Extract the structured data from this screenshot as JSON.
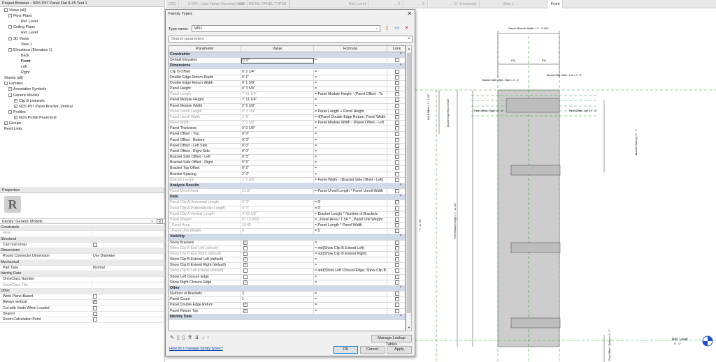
{
  "project_browser": {
    "title": "Project Browser - NDS P57 Panel Flat 8-15 Test 1",
    "items": [
      {
        "label": "Views (all)",
        "depth": 0,
        "toggle": "-"
      },
      {
        "label": "Floor Plans",
        "depth": 1,
        "toggle": "-"
      },
      {
        "label": "Ref. Level",
        "depth": 3,
        "toggle": ""
      },
      {
        "label": "Ceiling Plans",
        "depth": 1,
        "toggle": "-"
      },
      {
        "label": "Ref. Level",
        "depth": 3,
        "toggle": ""
      },
      {
        "label": "3D Views",
        "depth": 1,
        "toggle": "-"
      },
      {
        "label": "View 1",
        "depth": 3,
        "toggle": ""
      },
      {
        "label": "Elevations (Elevation 1)",
        "depth": 1,
        "toggle": "-"
      },
      {
        "label": "Back",
        "depth": 3,
        "toggle": ""
      },
      {
        "label": "Front",
        "depth": 3,
        "toggle": "",
        "bold": true
      },
      {
        "label": "Left",
        "depth": 3,
        "toggle": ""
      },
      {
        "label": "Right",
        "depth": 3,
        "toggle": ""
      },
      {
        "label": "Sheets (all)",
        "depth": 0,
        "toggle": ""
      },
      {
        "label": "Families",
        "depth": 0,
        "toggle": "-"
      },
      {
        "label": "Annotation Symbols",
        "depth": 1,
        "toggle": "+"
      },
      {
        "label": "Generic Models",
        "depth": 1,
        "toggle": "-"
      },
      {
        "label": "Clip B Linework",
        "depth": 2,
        "toggle": "+"
      },
      {
        "label": "NDS P57 Panel Bracket_Vertical",
        "depth": 2,
        "toggle": "+"
      },
      {
        "label": "Profiles",
        "depth": 1,
        "toggle": "-"
      },
      {
        "label": "NDS Profile Panel End",
        "depth": 2,
        "toggle": "+"
      },
      {
        "label": "Groups",
        "depth": 0,
        "toggle": "+"
      },
      {
        "label": "Revit Links",
        "depth": 0,
        "toggle": ""
      }
    ]
  },
  "properties": {
    "title": "Properties",
    "logo_letter": "R",
    "family_label": "Family: Generic Models",
    "rows": [
      {
        "k": "Constraints",
        "sec": true
      },
      {
        "k": "Host",
        "v": "",
        "gray": true
      },
      {
        "k": "Structural",
        "sec": true
      },
      {
        "k": "Can host rebar",
        "cb": false
      },
      {
        "k": "Dimensions",
        "sec": true
      },
      {
        "k": "Round Connector Dimension",
        "v": "Use Diameter"
      },
      {
        "k": "Mechanical",
        "sec": true
      },
      {
        "k": "Part Type",
        "v": "Normal"
      },
      {
        "k": "Identity Data",
        "sec": true
      },
      {
        "k": "OmniClass Number",
        "v": ""
      },
      {
        "k": "OmniClass Title",
        "v": "",
        "gray": true
      },
      {
        "k": "Other",
        "sec": true
      },
      {
        "k": "Work Plane-Based",
        "cb": false
      },
      {
        "k": "Always vertical",
        "cb": true
      },
      {
        "k": "Cut with Voids When Loaded",
        "cb": false
      },
      {
        "k": "Shared",
        "cb": false
      },
      {
        "k": "Room Calculation Point",
        "cb": false
      }
    ]
  },
  "tabs": [
    {
      "label": "{3D}",
      "active": false
    },
    {
      "label": "3-000 - Liber Nolan Opening View",
      "active": false
    },
    {
      "label": "CW - METAL PANEL TYPES",
      "active": false
    },
    {
      "label": "1",
      "active": false
    },
    {
      "label": "Ref. Level",
      "active": false
    },
    {
      "label": "2",
      "active": false
    },
    {
      "label": "3",
      "active": false
    },
    {
      "label": "3 - Unnamed",
      "active": false
    },
    {
      "label": "View 1",
      "active": false
    },
    {
      "label": "Front",
      "active": true
    }
  ],
  "dialog": {
    "title": "Family Types",
    "close": "✕",
    "type_name_label": "Type name:",
    "type_name": "W01",
    "search_placeholder": "Search parameters",
    "columns": [
      "Parameter",
      "Value",
      "Formula",
      "Lock"
    ],
    "rows": [
      {
        "sec": "Constraints"
      },
      {
        "p": "Default Elevation",
        "v": "0' 0\"",
        "f": "=",
        "lock": false,
        "dflt": true
      },
      {
        "sec": "Dimensions"
      },
      {
        "p": "Clip B Offset",
        "v": "0' 2 1/4\"",
        "f": "=",
        "lock": false
      },
      {
        "p": "Double Edge Return Depth",
        "v": "0' 1\"",
        "f": "=",
        "lock": false
      },
      {
        "p": "Double Edge Return Width",
        "v": "0' 1 5/8\"",
        "f": "=",
        "lock": false
      },
      {
        "p": "Panel Height",
        "v": "0' 3 5/8\"",
        "f": "=",
        "lock": false
      },
      {
        "p": "Panel Length",
        "v": "7' 11 1/4\"",
        "f": "= Panel Module Height - (Panel Offset - To",
        "lock": false,
        "gray": true
      },
      {
        "p": "Panel Module Height",
        "v": "7' 11 1/4\"",
        "f": "=",
        "lock": false
      },
      {
        "p": "Panel Module Width",
        "v": "2' 5 3/8\"",
        "f": "=",
        "lock": false
      },
      {
        "p": "Panel Unroll Length",
        "v": "8' 2 7/8\"",
        "f": "= Panel Length + Panel Height",
        "lock": false,
        "gray": true
      },
      {
        "p": "Panel Unroll Width",
        "v": "2' 8\"",
        "f": "= if(Panel Double Edge Return, Panel Width",
        "lock": false,
        "gray": true
      },
      {
        "p": "Panel Width",
        "v": "2' 5 3/8\"",
        "f": "= Panel Module Width - (Panel Offset - Left",
        "lock": false,
        "gray": true
      },
      {
        "p": "Panel Thickness",
        "v": "0' 0 1/8\"",
        "f": "=",
        "lock": false
      },
      {
        "p": "Panel Offset - Top",
        "v": "0' 0\"",
        "f": "=",
        "lock": false
      },
      {
        "p": "Panel Offset - Bottom",
        "v": "0' 0\"",
        "f": "=",
        "lock": false
      },
      {
        "p": "Panel Offset - Left Side",
        "v": "0' 0\"",
        "f": "=",
        "lock": false
      },
      {
        "p": "Panel Offset - Right Side",
        "v": "0' 0\"",
        "f": "=",
        "lock": false
      },
      {
        "p": "Bracket Side Offset - Left",
        "v": "0' 5\"",
        "f": "=",
        "lock": false
      },
      {
        "p": "Bracket Side Offset - Right",
        "v": "0' 5\"",
        "f": "=",
        "lock": false
      },
      {
        "p": "Bracket Top Offset",
        "v": "0' 5\"",
        "f": "=",
        "lock": false
      },
      {
        "p": "Bracket Spacing",
        "v": "2' 0\"",
        "f": "=",
        "lock": false
      },
      {
        "p": "Bracket Length",
        "v": "1' 7 3/8\"",
        "f": "= Panel Width - (Bracket Side Offset - Left)",
        "lock": false,
        "gray": true
      },
      {
        "sec": "Analysis Results"
      },
      {
        "p": "Panel Unroll Area",
        "v": "21.97",
        "f": "= Panel Unroll Length * Panel Unroll Width",
        "lock": false,
        "gray": true
      },
      {
        "sec": "Data"
      },
      {
        "p": "Panel Clip A Horizontal Length",
        "v": "0' 0\"",
        "f": "= 0'",
        "lock": false,
        "gray": true
      },
      {
        "p": "Panel Clip A Perpendicular Length",
        "v": "0' 0\"",
        "f": "= 0'",
        "lock": false,
        "gray": true
      },
      {
        "p": "Panel Clip A Vertical Length",
        "v": "4' 10 1/8\"",
        "f": "= Bracket Length * Number of Brackets",
        "lock": false,
        "gray": true
      },
      {
        "p": "Panel Weight",
        "v": "97.151693",
        "f": "= _Panel Area / 1 SF * _Panel Unit Weight",
        "lock": false,
        "gray": true
      },
      {
        "p": "_Panel Area",
        "v": "19.43",
        "f": "= Panel Length * Panel Width",
        "lock": false,
        "gray": true
      },
      {
        "p": "_Panel Unit Weight",
        "v": "5",
        "f": "= 5",
        "lock": false,
        "gray": true
      },
      {
        "sec": "Visibility"
      },
      {
        "p": "Show Brackets",
        "vcb": true,
        "f": "=",
        "lock": false
      },
      {
        "p": "Show Clip B End Left (default)",
        "vcb": false,
        "f": "= not(Show Clip B Extend Left)",
        "lock": false,
        "gray": true
      },
      {
        "p": "Show Clip B End Right (default)",
        "vcb": false,
        "f": "= not(Show Clip B Extend Right)",
        "lock": false,
        "gray": true
      },
      {
        "p": "Show Clip B Extend Left (default)",
        "vcb": true,
        "f": "=",
        "lock": false
      },
      {
        "p": "Show Clip B Extend Right (default)",
        "vcb": true,
        "f": "=",
        "lock": false
      },
      {
        "p": "Show Clip B Left Extend (default)",
        "vcb": false,
        "f": "= and(Show Left Closure Edge, Show Clip B",
        "lock": false,
        "gray": true
      },
      {
        "p": "Show Left Closure Edge",
        "vcb": false,
        "f": "=",
        "lock": false
      },
      {
        "p": "Show Right Closure Edge",
        "vcb": true,
        "f": "=",
        "lock": false
      },
      {
        "sec": "Other"
      },
      {
        "p": "Number of Brackets",
        "v": "3",
        "f": "=",
        "lock": false
      },
      {
        "p": "Panel Count",
        "v": "1",
        "f": "=",
        "lock": false
      },
      {
        "p": "Panel Double Edge Return",
        "vcb": true,
        "f": "=",
        "lock": false
      },
      {
        "p": "Panel Return Top",
        "vcb": true,
        "f": "=",
        "lock": false
      },
      {
        "sec": "Identity Data"
      }
    ],
    "manage_lookup": "Manage Lookup Tables",
    "help_link": "How do I manage family types?",
    "ok": "OK",
    "cancel": "Cancel",
    "apply": "Apply"
  },
  "drawing": {
    "dim_top": "Panel Module Width = 2' - 5 3/8\"",
    "dim_eq": "EQ",
    "bracket_left": "Bracket Side Offset - Right = 0' - 5\"",
    "bracket_right": "Bracket Side Offset - Left = 0' - 5\"",
    "clip_left": "Clip B Offset = 0' - 2 1/4\"",
    "dbl_edge": "Double Edge Return Width",
    "bracket_top": "Bracket Top Offset = 0' - 5\"",
    "panel_offset_top_l": "Panel Offset - Right = 0' - 0\"",
    "panel_offset_top_r": "Panel Offset - Left = 0' - 0\"",
    "bracket_spacing": "Bracket Spacing = 2' - 0\"",
    "overall": "7' - 11 1/4\"",
    "module_height": "Panel Module Height = 7' - 11 1/4\"",
    "panel_offset_bottom": "Panel Offset - Bottom = 0' - 0\"",
    "ref_level": "Ref. Level",
    "ref_level_elev": "0' - 0\""
  }
}
